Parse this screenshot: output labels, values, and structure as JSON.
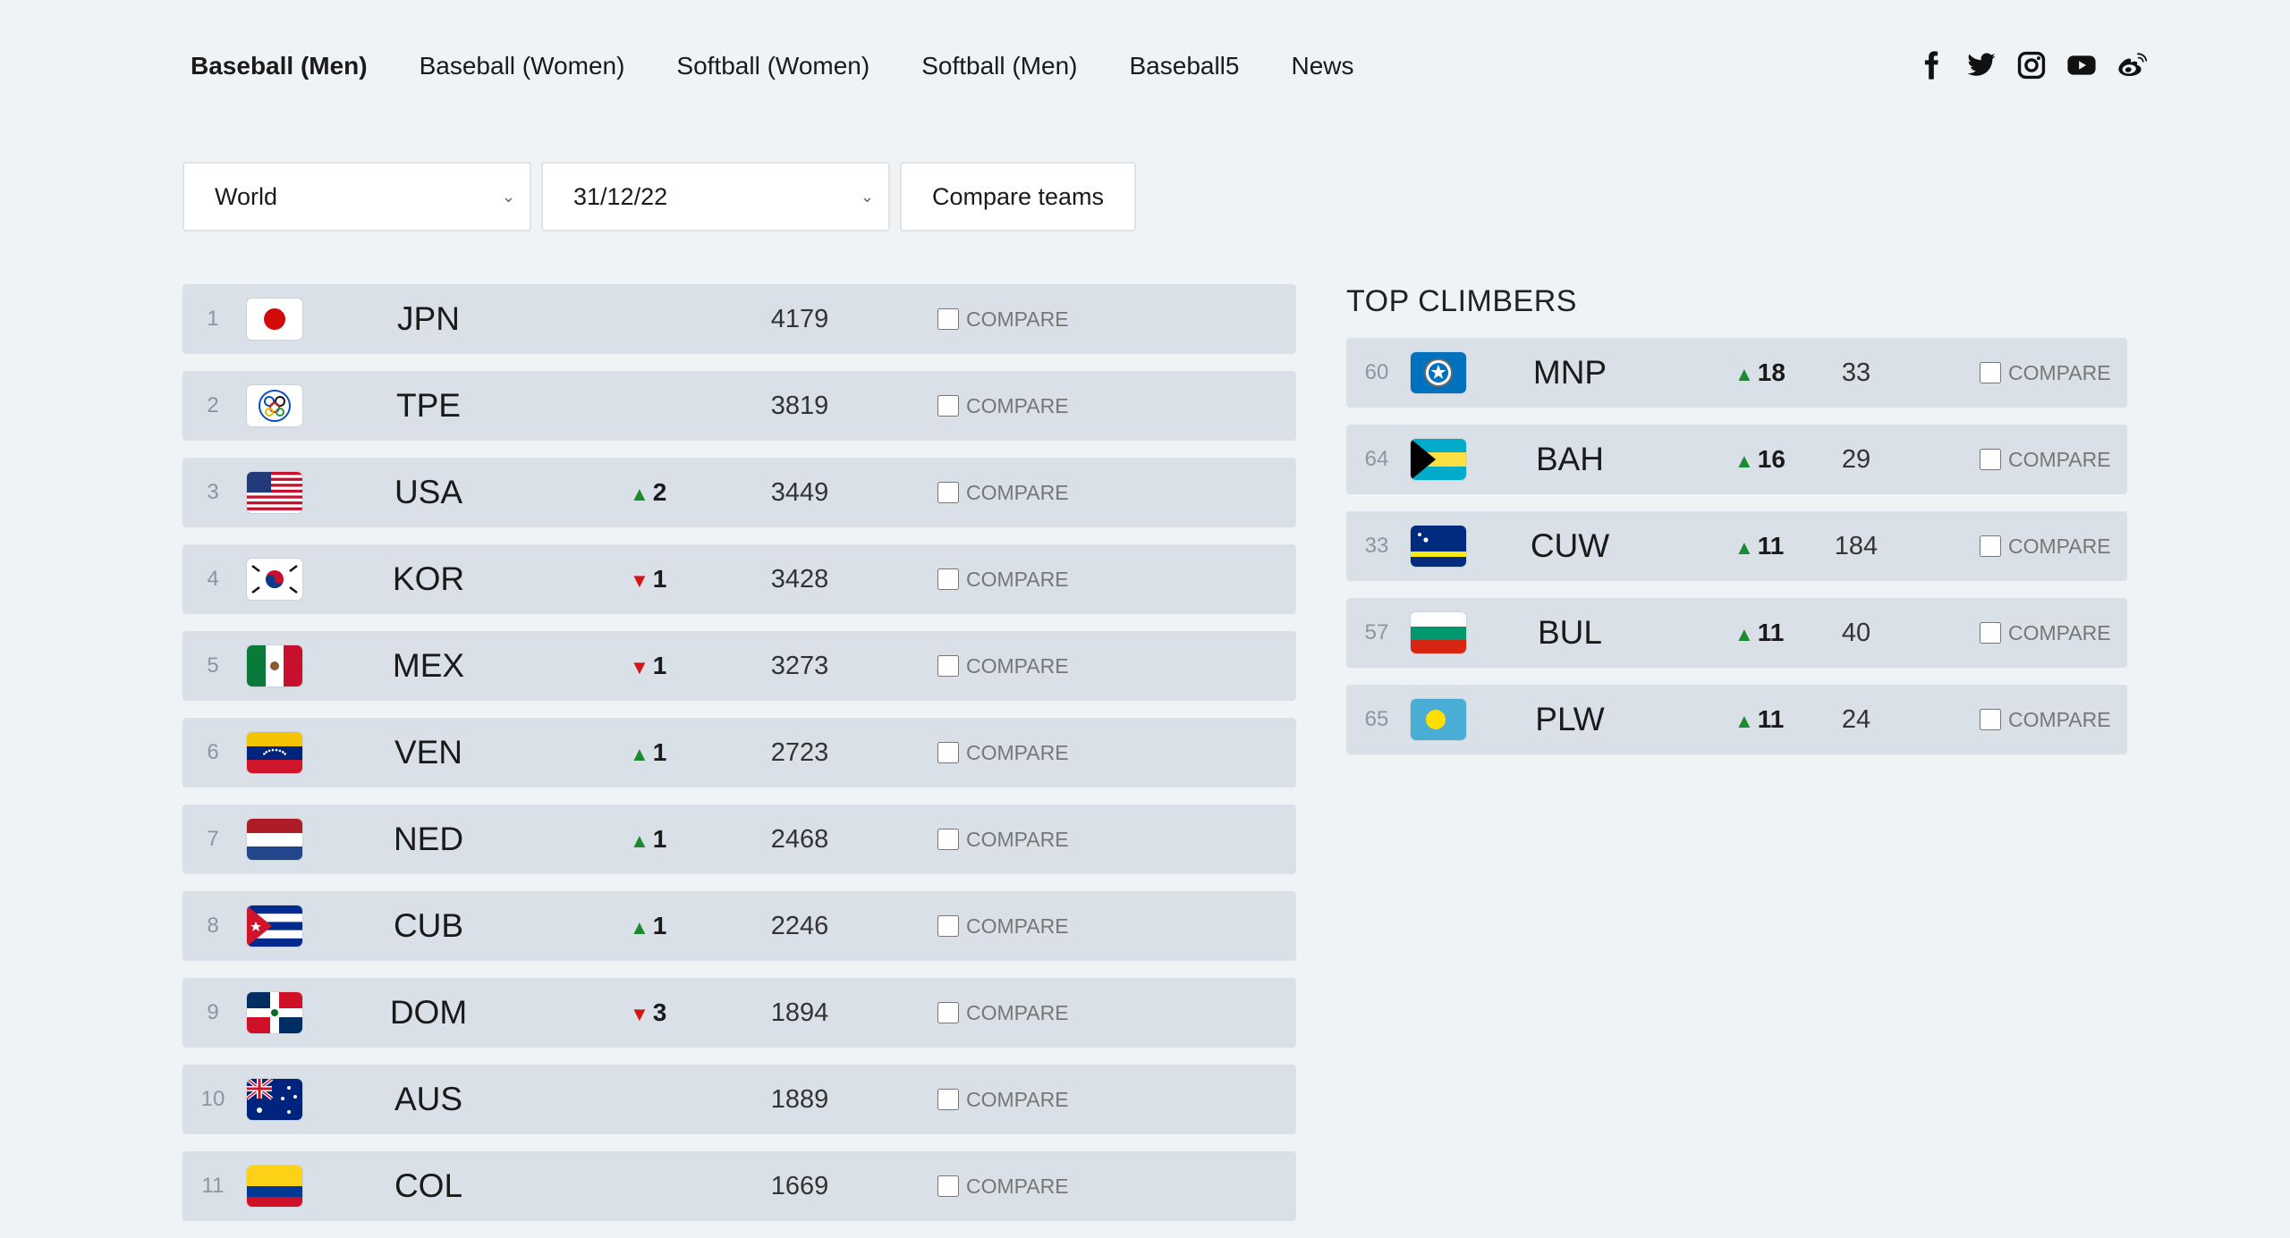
{
  "nav": {
    "tabs": [
      {
        "label": "Baseball (Men)",
        "active": true
      },
      {
        "label": "Baseball (Women)",
        "active": false
      },
      {
        "label": "Softball (Women)",
        "active": false
      },
      {
        "label": "Softball (Men)",
        "active": false
      },
      {
        "label": "Baseball5",
        "active": false
      },
      {
        "label": "News",
        "active": false
      }
    ],
    "social": [
      "facebook-icon",
      "twitter-icon",
      "instagram-icon",
      "youtube-icon",
      "weibo-icon"
    ]
  },
  "filters": {
    "region": "World",
    "date": "31/12/22",
    "compare_label": "Compare teams"
  },
  "compare_label": "COMPARE",
  "ranking": [
    {
      "rank": "1",
      "code": "JPN",
      "dir": "",
      "delta": "",
      "points": "4179",
      "flag": "jpn"
    },
    {
      "rank": "2",
      "code": "TPE",
      "dir": "",
      "delta": "",
      "points": "3819",
      "flag": "tpe"
    },
    {
      "rank": "3",
      "code": "USA",
      "dir": "up",
      "delta": "2",
      "points": "3449",
      "flag": "usa"
    },
    {
      "rank": "4",
      "code": "KOR",
      "dir": "down",
      "delta": "1",
      "points": "3428",
      "flag": "kor"
    },
    {
      "rank": "5",
      "code": "MEX",
      "dir": "down",
      "delta": "1",
      "points": "3273",
      "flag": "mex"
    },
    {
      "rank": "6",
      "code": "VEN",
      "dir": "up",
      "delta": "1",
      "points": "2723",
      "flag": "ven"
    },
    {
      "rank": "7",
      "code": "NED",
      "dir": "up",
      "delta": "1",
      "points": "2468",
      "flag": "ned"
    },
    {
      "rank": "8",
      "code": "CUB",
      "dir": "up",
      "delta": "1",
      "points": "2246",
      "flag": "cub"
    },
    {
      "rank": "9",
      "code": "DOM",
      "dir": "down",
      "delta": "3",
      "points": "1894",
      "flag": "dom"
    },
    {
      "rank": "10",
      "code": "AUS",
      "dir": "",
      "delta": "",
      "points": "1889",
      "flag": "aus"
    },
    {
      "rank": "11",
      "code": "COL",
      "dir": "",
      "delta": "",
      "points": "1669",
      "flag": "col"
    }
  ],
  "climbers": {
    "title": "TOP CLIMBERS",
    "items": [
      {
        "rank": "60",
        "code": "MNP",
        "dir": "up",
        "delta": "18",
        "points": "33",
        "flag": "mnp"
      },
      {
        "rank": "64",
        "code": "BAH",
        "dir": "up",
        "delta": "16",
        "points": "29",
        "flag": "bah"
      },
      {
        "rank": "33",
        "code": "CUW",
        "dir": "up",
        "delta": "11",
        "points": "184",
        "flag": "cuw"
      },
      {
        "rank": "57",
        "code": "BUL",
        "dir": "up",
        "delta": "11",
        "points": "40",
        "flag": "bul"
      },
      {
        "rank": "65",
        "code": "PLW",
        "dir": "up",
        "delta": "11",
        "points": "24",
        "flag": "plw"
      }
    ]
  }
}
